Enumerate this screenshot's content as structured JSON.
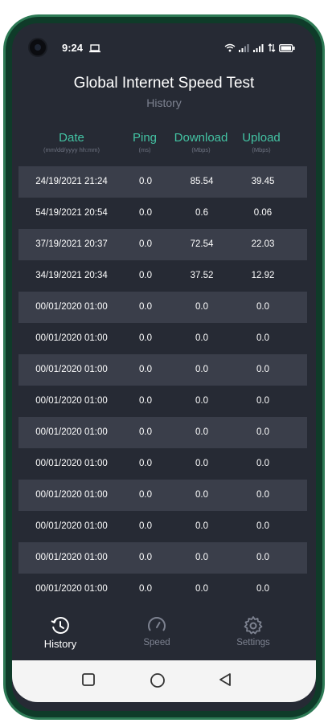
{
  "status_bar": {
    "time": "9:24"
  },
  "header": {
    "title": "Global Internet Speed Test",
    "subtitle": "History"
  },
  "columns": [
    {
      "label": "Date",
      "unit": "(mm/dd/yyyy hh:mm)"
    },
    {
      "label": "Ping",
      "unit": "(ms)"
    },
    {
      "label": "Download",
      "unit": "(Mbps)"
    },
    {
      "label": "Upload",
      "unit": "(Mbps)"
    }
  ],
  "rows": [
    {
      "date": "24/19/2021 21:24",
      "ping": "0.0",
      "download": "85.54",
      "upload": "39.45"
    },
    {
      "date": "54/19/2021 20:54",
      "ping": "0.0",
      "download": "0.6",
      "upload": "0.06"
    },
    {
      "date": "37/19/2021 20:37",
      "ping": "0.0",
      "download": "72.54",
      "upload": "22.03"
    },
    {
      "date": "34/19/2021 20:34",
      "ping": "0.0",
      "download": "37.52",
      "upload": "12.92"
    },
    {
      "date": "00/01/2020 01:00",
      "ping": "0.0",
      "download": "0.0",
      "upload": "0.0"
    },
    {
      "date": "00/01/2020 01:00",
      "ping": "0.0",
      "download": "0.0",
      "upload": "0.0"
    },
    {
      "date": "00/01/2020 01:00",
      "ping": "0.0",
      "download": "0.0",
      "upload": "0.0"
    },
    {
      "date": "00/01/2020 01:00",
      "ping": "0.0",
      "download": "0.0",
      "upload": "0.0"
    },
    {
      "date": "00/01/2020 01:00",
      "ping": "0.0",
      "download": "0.0",
      "upload": "0.0"
    },
    {
      "date": "00/01/2020 01:00",
      "ping": "0.0",
      "download": "0.0",
      "upload": "0.0"
    },
    {
      "date": "00/01/2020 01:00",
      "ping": "0.0",
      "download": "0.0",
      "upload": "0.0"
    },
    {
      "date": "00/01/2020 01:00",
      "ping": "0.0",
      "download": "0.0",
      "upload": "0.0"
    },
    {
      "date": "00/01/2020 01:00",
      "ping": "0.0",
      "download": "0.0",
      "upload": "0.0"
    },
    {
      "date": "00/01/2020 01:00",
      "ping": "0.0",
      "download": "0.0",
      "upload": "0.0"
    }
  ],
  "bottom_nav": {
    "history": {
      "label": "History",
      "icon": "history-icon"
    },
    "speed": {
      "label": "Speed",
      "icon": "speedometer-icon"
    },
    "settings": {
      "label": "Settings",
      "icon": "gear-icon"
    }
  },
  "colors": {
    "accent": "#43c3a3",
    "background": "#262a34",
    "row_alt": "#3a3e4a",
    "frame": "#2d7a55"
  }
}
